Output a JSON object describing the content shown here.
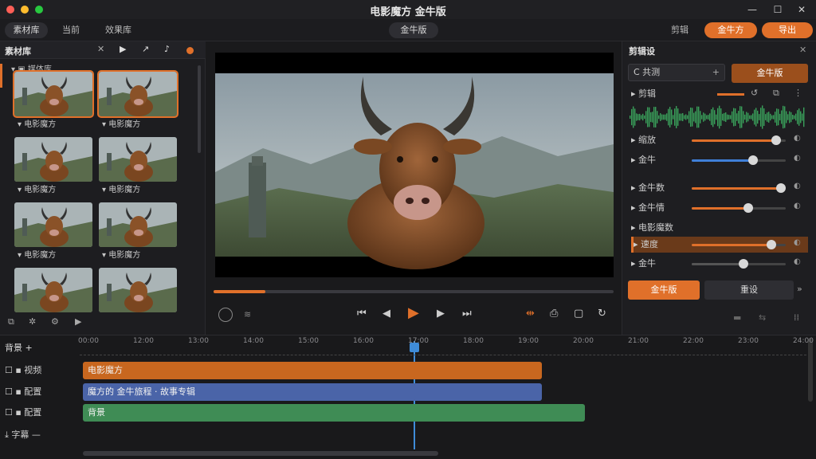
{
  "window": {
    "title": "电影魔方 金牛版",
    "minimize": "—",
    "maximize": "☐",
    "close": "✕"
  },
  "topbar": {
    "tabs": [
      "素材库",
      "当前",
      "效果库"
    ],
    "center_badge": "金牛版",
    "right_label": "剪辑",
    "btn_primary": "金牛方",
    "btn_export": "导出"
  },
  "media": {
    "header": "素材库",
    "folder": "媒体库",
    "items": [
      {
        "label": "电影魔方",
        "selected": true
      },
      {
        "label": "电影魔方",
        "selected": true
      },
      {
        "label": "电影魔方",
        "selected": false
      },
      {
        "label": "电影魔方",
        "selected": false
      },
      {
        "label": "电影魔方",
        "selected": false
      },
      {
        "label": "电影魔方",
        "selected": false
      },
      {
        "label": "",
        "selected": false
      },
      {
        "label": "",
        "selected": false
      }
    ]
  },
  "player": {
    "progress": 0.13
  },
  "inspector": {
    "title": "剪辑设",
    "search_value": "C 共测",
    "badge": "金牛版",
    "section_clip": "剪辑",
    "props": [
      {
        "label": "缩放",
        "value": 0.9,
        "accent": "#e0702a"
      },
      {
        "label": "金牛",
        "value": 0.65,
        "accent": "#3f7fd8"
      },
      {
        "label": "金牛数",
        "value": 0.95,
        "accent": "#e0702a"
      },
      {
        "label": "金牛情",
        "value": 0.6,
        "accent": "#e0702a"
      },
      {
        "label": "电影魔数",
        "value": null,
        "accent": null
      },
      {
        "label": "速度",
        "value": 0.85,
        "accent": "#e0702a"
      },
      {
        "label": "金牛",
        "value": 0.55,
        "accent": "#555"
      }
    ],
    "btn_apply": "金牛版",
    "btn_reset": "重设"
  },
  "timeline": {
    "ticks": [
      "00:00",
      "12:00",
      "13:00",
      "14:00",
      "15:00",
      "16:00",
      "17:00",
      "18:00",
      "19:00",
      "20:00",
      "21:00",
      "22:00",
      "23:00",
      "24:00"
    ],
    "tracks": [
      {
        "label": "视频",
        "clip": "电影魔方",
        "color": "#c8671f"
      },
      {
        "label": "配置",
        "clip": "魔方的 金牛旅程 · 故事专辑",
        "color": "#4a64a8"
      },
      {
        "label": "配置",
        "clip": "背景",
        "color": "#3f8c55"
      },
      {
        "label": "字幕 —",
        "clip": "",
        "color": ""
      }
    ],
    "header_label": "背景 +"
  },
  "colors": {
    "accent": "#e0702a",
    "playhead": "#3f8cd8",
    "audio": "#3aa05a"
  }
}
